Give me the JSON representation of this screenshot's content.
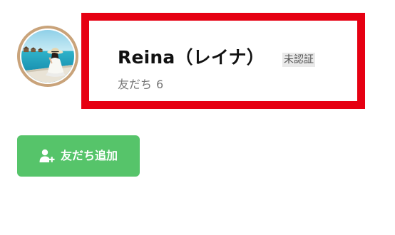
{
  "profile": {
    "name": "Reina（レイナ）",
    "verification_badge": "未認証",
    "friends_label": "友だち",
    "friends_count": "6"
  },
  "actions": {
    "add_friend_label": "友だち追加"
  },
  "colors": {
    "highlight_border": "#e60012",
    "add_button_bg": "#56c46a",
    "avatar_ring": "#c9a37a"
  },
  "icons": {
    "add_friend": "person-plus-icon"
  }
}
